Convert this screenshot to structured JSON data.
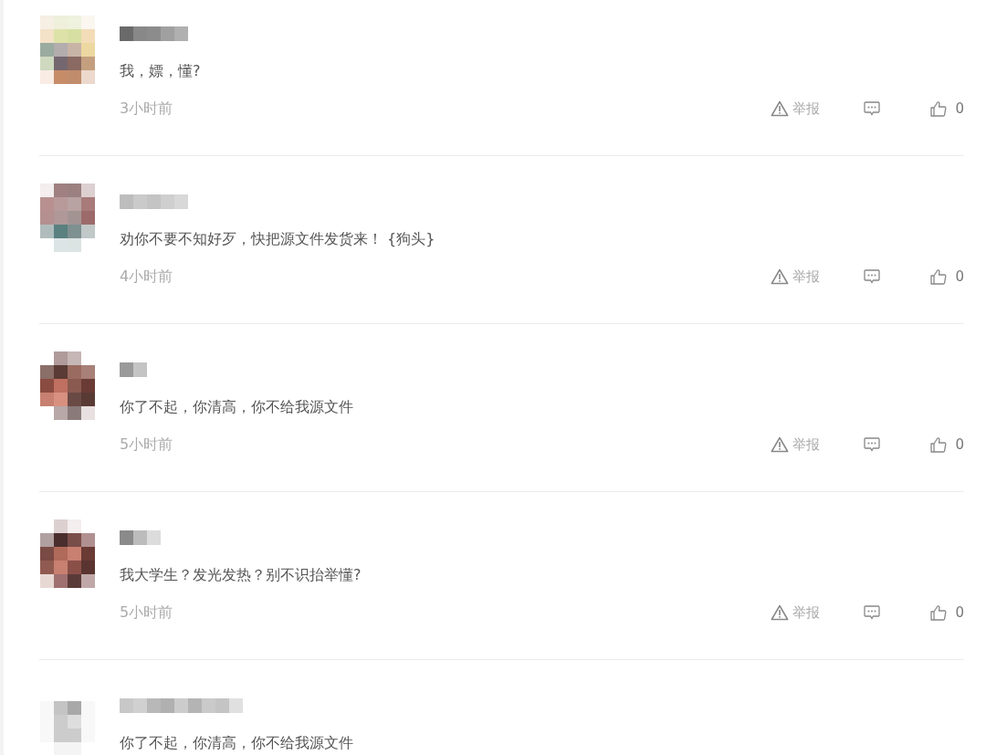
{
  "comments": [
    {
      "text": "我，嫖，懂?",
      "time": "3小时前",
      "report": "举报",
      "likes": "0"
    },
    {
      "text": "劝你不要不知好歹，快把源文件发货来！ {狗头}",
      "time": "4小时前",
      "report": "举报",
      "likes": "0"
    },
    {
      "text": "你了不起，你清高，你不给我源文件",
      "time": "5小时前",
      "report": "举报",
      "likes": "0"
    },
    {
      "text": "我大学生？发光发热？别不识抬举懂?",
      "time": "5小时前",
      "report": "举报",
      "likes": "0"
    },
    {
      "text": "你了不起，你清高，你不给我源文件"
    }
  ]
}
